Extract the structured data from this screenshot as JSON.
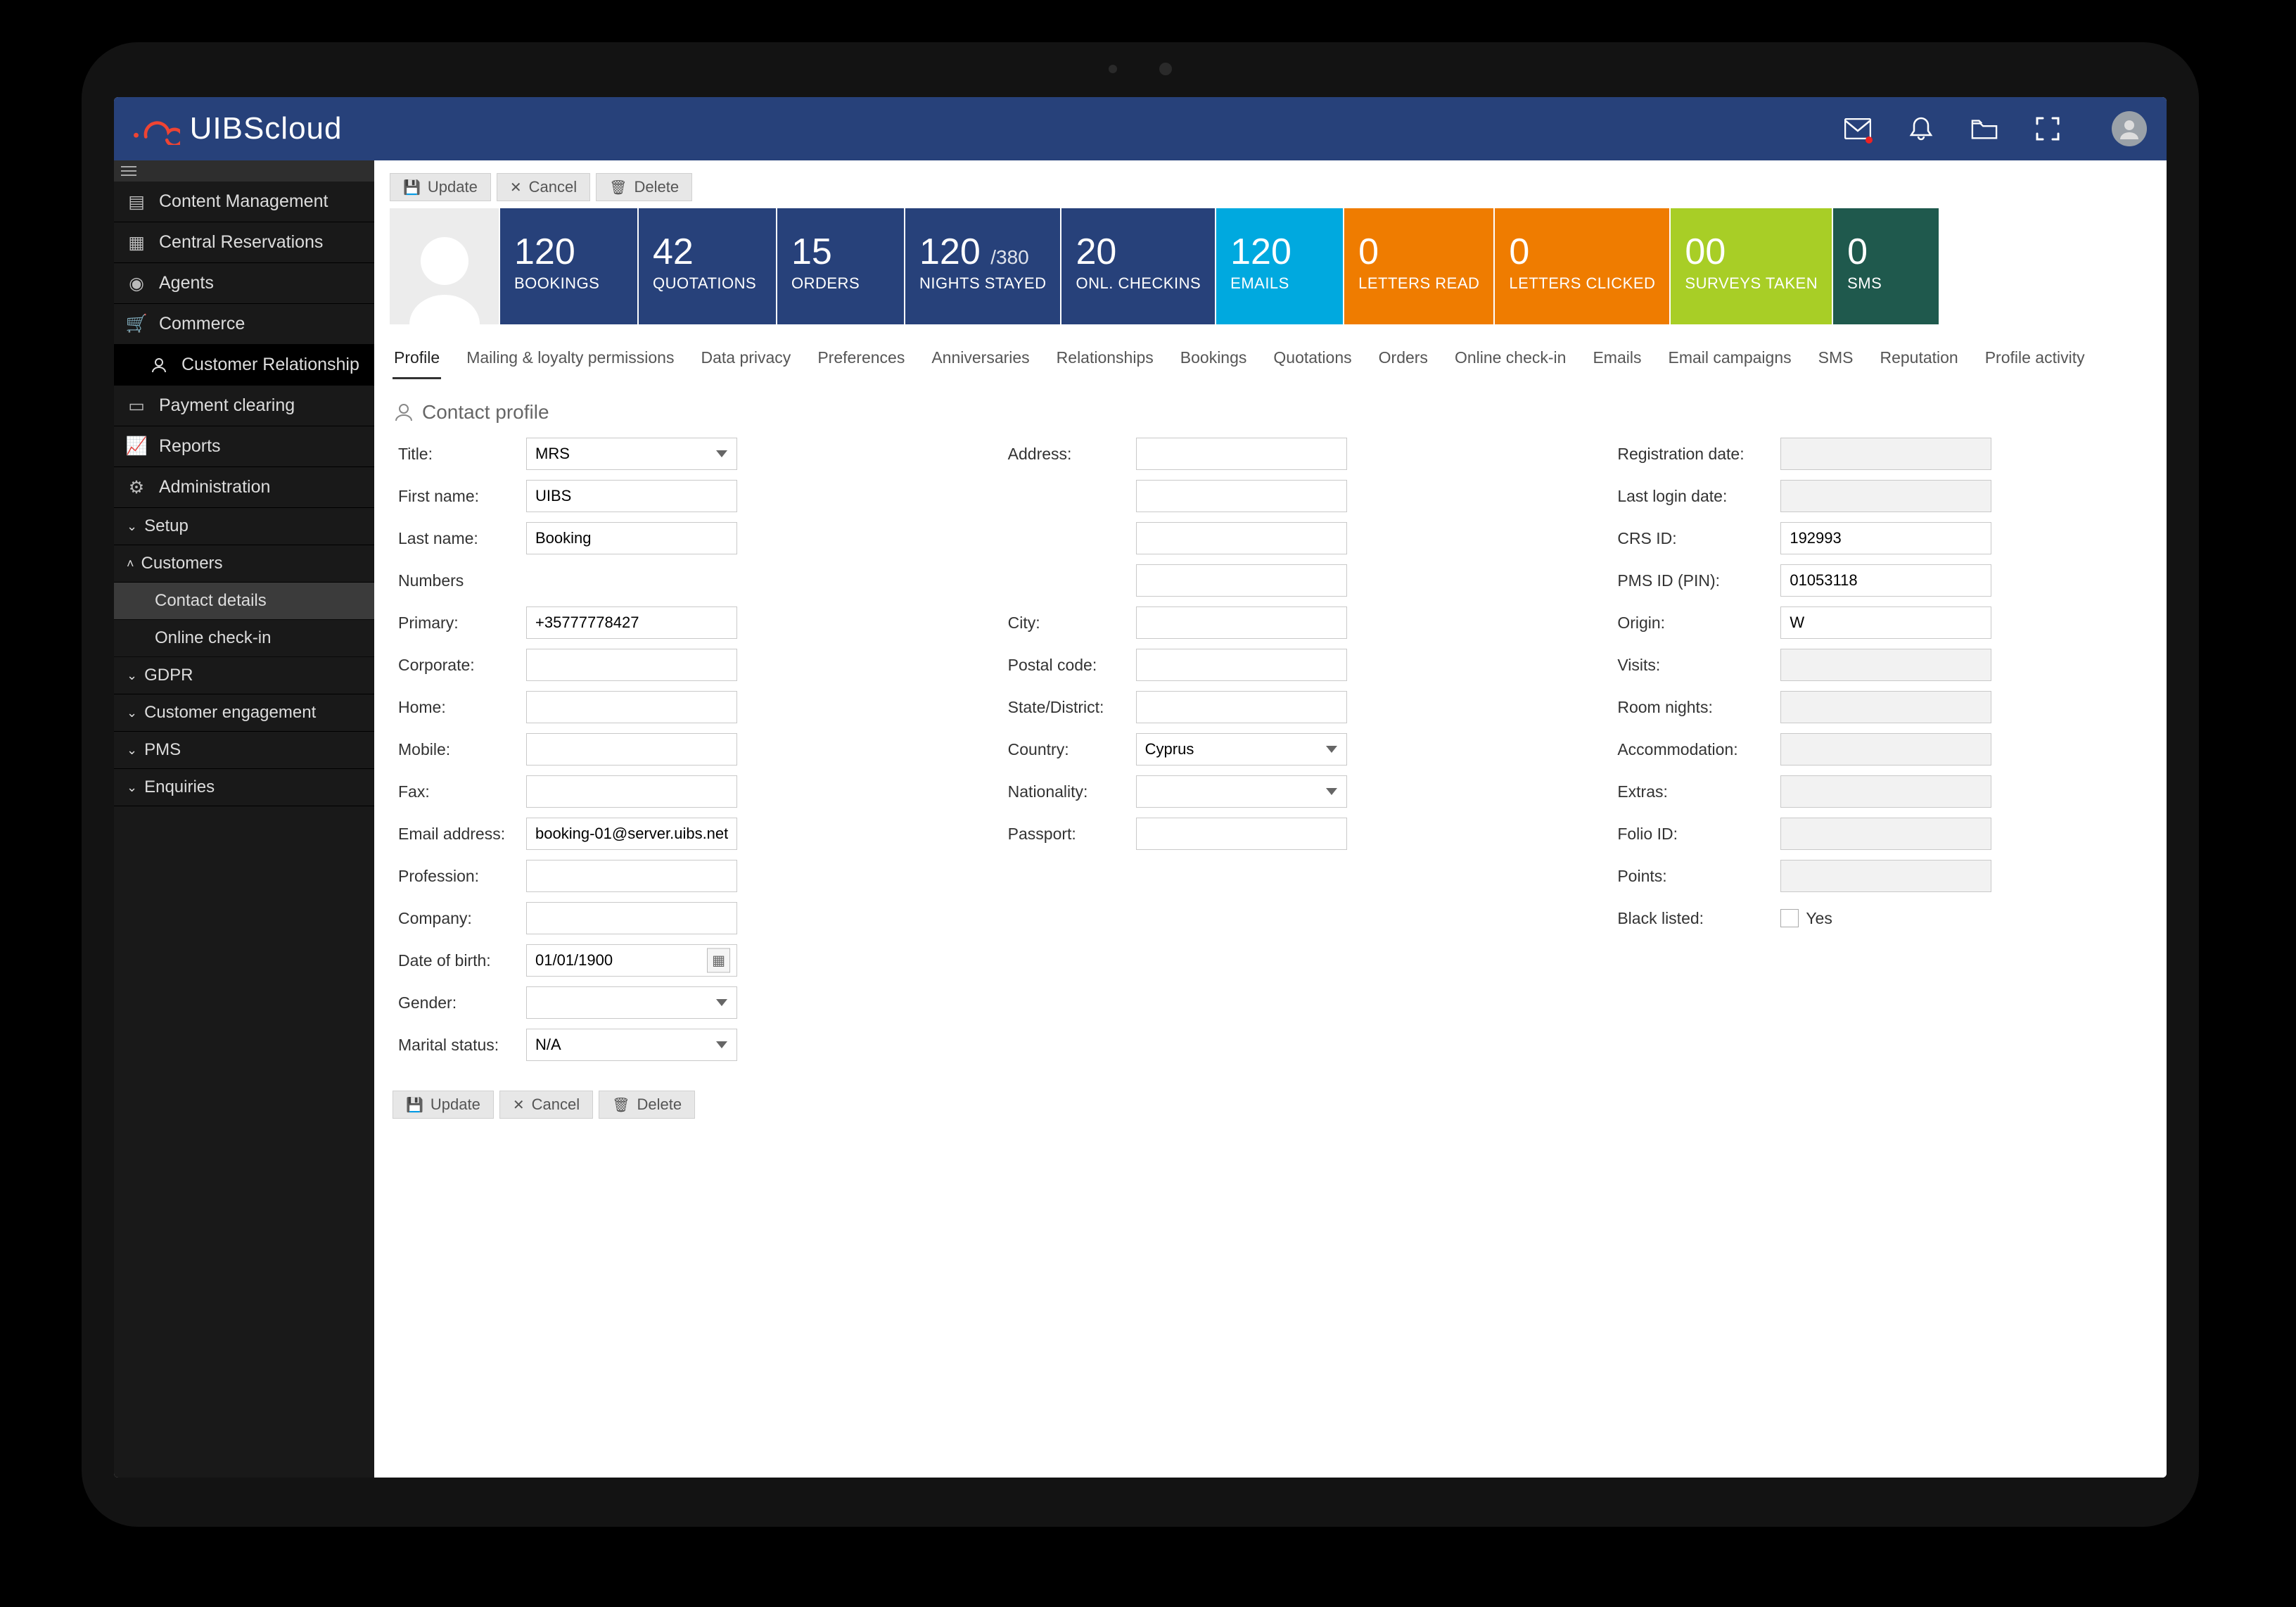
{
  "brand": "UIBScloud",
  "toolbar": {
    "update": "Update",
    "cancel": "Cancel",
    "delete": "Delete"
  },
  "nav": {
    "items": [
      "Content Management",
      "Central Reservations",
      "Agents",
      "Commerce",
      "Customer Relationship",
      "Payment clearing",
      "Reports",
      "Administration"
    ],
    "groups": {
      "setup": "Setup",
      "customers": "Customers",
      "gdpr": "GDPR",
      "engagement": "Customer engagement",
      "pms": "PMS",
      "enquiries": "Enquiries"
    },
    "subs": {
      "contact_details": "Contact details",
      "online_checkin": "Online check-in"
    }
  },
  "stats": {
    "bookings": {
      "value": "120",
      "label": "BOOKINGS"
    },
    "quotations": {
      "value": "42",
      "label": "QUOTATIONS"
    },
    "orders": {
      "value": "15",
      "label": "ORDERS"
    },
    "nights": {
      "value": "120",
      "total": "/380",
      "label": "NIGHTS STAYED"
    },
    "checkins": {
      "value": "20",
      "label": "ONL. CHECKINS"
    },
    "emails": {
      "value": "120",
      "label": "EMAILS"
    },
    "letters_read": {
      "value": "0",
      "label": "LETTERS READ"
    },
    "letters_clicked": {
      "value": "0",
      "label": "LETTERS CLICKED"
    },
    "surveys": {
      "value": "00",
      "label": "SURVEYS TAKEN"
    },
    "sms": {
      "value": "0",
      "label": "SMS"
    }
  },
  "tabs": [
    "Profile",
    "Mailing & loyalty permissions",
    "Data privacy",
    "Preferences",
    "Anniversaries",
    "Relationships",
    "Bookings",
    "Quotations",
    "Orders",
    "Online check-in",
    "Emails",
    "Email campaigns",
    "SMS",
    "Reputation",
    "Profile activity"
  ],
  "section_title": "Contact profile",
  "labels": {
    "title": "Title:",
    "first_name": "First name:",
    "last_name": "Last name:",
    "numbers": "Numbers",
    "primary": "Primary:",
    "corporate": "Corporate:",
    "home": "Home:",
    "mobile": "Mobile:",
    "fax": "Fax:",
    "email": "Email address:",
    "profession": "Profession:",
    "company": "Company:",
    "dob": "Date of birth:",
    "gender": "Gender:",
    "marital": "Marital status:",
    "address": "Address:",
    "city": "City:",
    "postal": "Postal code:",
    "state": "State/District:",
    "country": "Country:",
    "nationality": "Nationality:",
    "passport": "Passport:",
    "reg_date": "Registration date:",
    "last_login": "Last login date:",
    "crs_id": "CRS ID:",
    "pms_id": "PMS ID (PIN):",
    "origin": "Origin:",
    "visits": "Visits:",
    "room_nights": "Room nights:",
    "accommodation": "Accommodation:",
    "extras": "Extras:",
    "folio_id": "Folio ID:",
    "points": "Points:",
    "black_listed": "Black listed:",
    "yes": "Yes"
  },
  "values": {
    "title": "MRS",
    "first_name": "UIBS",
    "last_name": "Booking",
    "primary": "+35777778427",
    "corporate": "",
    "home": "",
    "mobile": "",
    "fax": "",
    "email": "booking-01@server.uibs.net",
    "profession": "",
    "company": "",
    "dob": "01/01/1900",
    "gender": "",
    "marital": "N/A",
    "address1": "",
    "address2": "",
    "address3": "",
    "address4": "",
    "city": "",
    "postal": "",
    "state": "",
    "country": "Cyprus",
    "nationality": "",
    "passport": "",
    "reg_date": "",
    "last_login": "",
    "crs_id": "192993",
    "pms_id": "01053118",
    "origin": "W",
    "visits": "",
    "room_nights": "",
    "accommodation": "",
    "extras": "",
    "folio_id": "",
    "points": ""
  }
}
